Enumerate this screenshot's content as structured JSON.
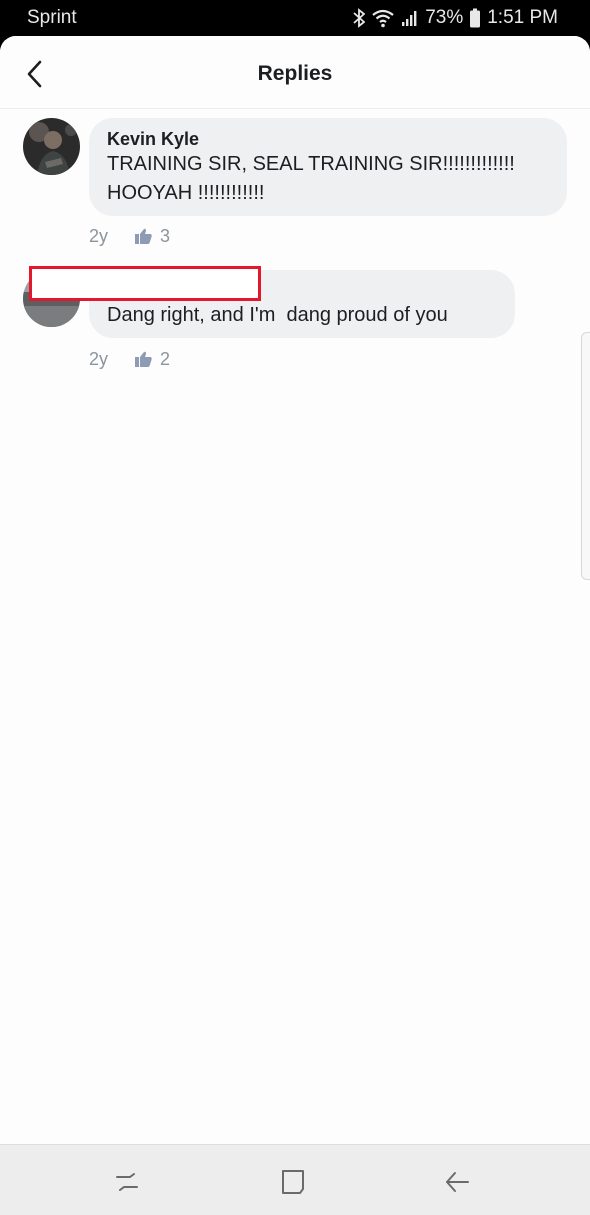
{
  "status_bar": {
    "carrier": "Sprint",
    "battery": "73%",
    "time": "1:51 PM",
    "icons": [
      "bluetooth-icon",
      "wifi-icon",
      "signal-icon",
      "battery-icon"
    ]
  },
  "header": {
    "title": "Replies",
    "back_icon": "chevron-left-icon"
  },
  "comments": [
    {
      "author": "Kevin Kyle",
      "text": "TRAINING SIR, SEAL TRAINING SIR!!!!!!!!!!!!!\nHOOYAH !!!!!!!!!!!!",
      "age": "2y",
      "likes": "3"
    },
    {
      "author": "",
      "text": "Dang right, and I'm  dang proud of you",
      "age": "2y",
      "likes": "2"
    }
  ],
  "nav_bar": {
    "icons": [
      "recent-apps-icon",
      "home-icon",
      "back-icon"
    ]
  },
  "colors": {
    "bubble": "#eff0f2",
    "meta_text": "#8d949e",
    "like_icon": "#8d9bb4",
    "redaction": "#e3182c"
  }
}
